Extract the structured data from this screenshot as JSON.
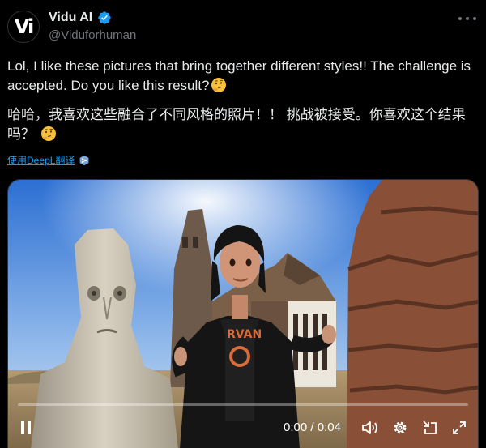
{
  "author": {
    "display_name": "Vidu AI",
    "handle": "@Viduforhuman",
    "avatar_text": "Vi",
    "verified_icon": "verified-badge-icon",
    "verified_color": "#1d9bf0"
  },
  "tweet": {
    "text_en": "Lol, I like these pictures that bring together different styles!! The challenge is accepted. Do you like this result?",
    "text_zh": "哈哈，我喜欢这些融合了不同风格的照片！！ 挑战被接受。你喜欢这个结果吗？",
    "emoji": "thinking-face-icon"
  },
  "translation": {
    "label": "使用DeepL翻译",
    "icon": "deepl-icon"
  },
  "video": {
    "current_time": "0:00",
    "duration": "0:04",
    "time_display": "0:00 / 0:04",
    "progress": 0.0,
    "shirt_text": "RVAN",
    "controls": [
      "pause-icon",
      "volume-icon",
      "settings-gear-icon",
      "minimize-player-icon",
      "fullscreen-icon"
    ]
  },
  "colors": {
    "background": "#000000",
    "text": "#e7e9ea",
    "secondary": "#71767b",
    "accent": "#1d9bf0"
  }
}
